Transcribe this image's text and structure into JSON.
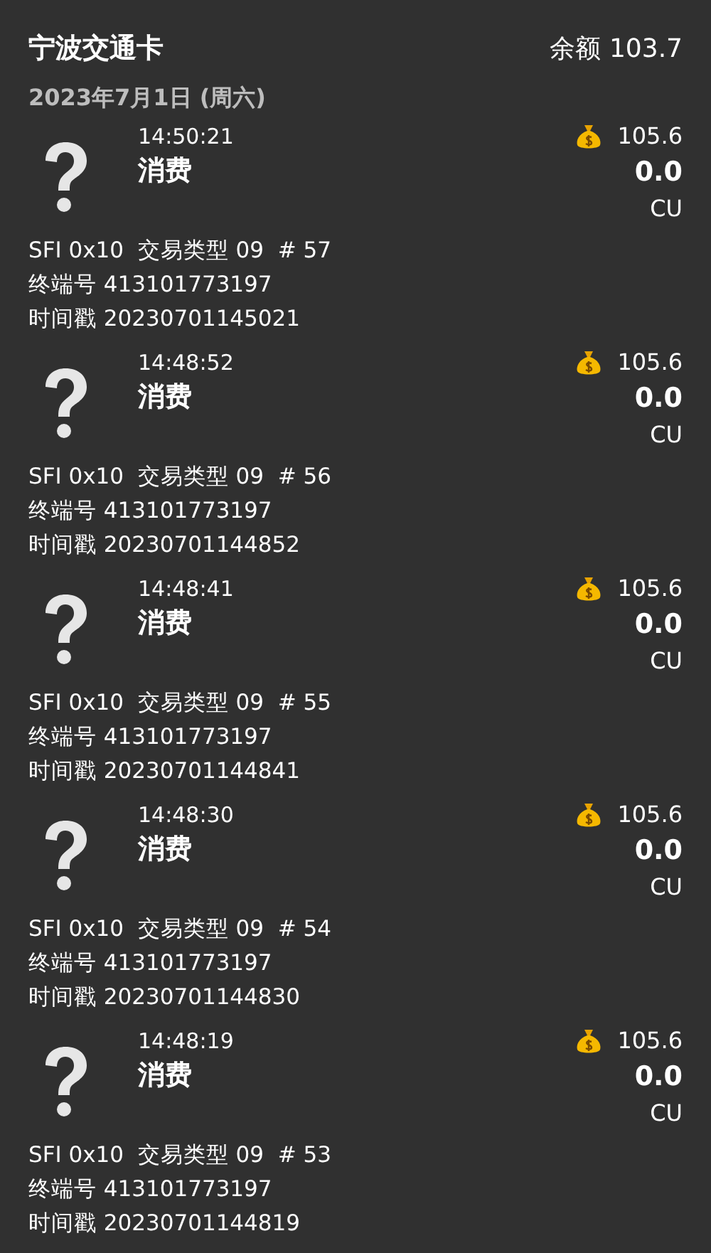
{
  "header": {
    "title": "宁波交通卡",
    "balance": "余额 103.7"
  },
  "date": "2023年7月1日 (周六)",
  "records": [
    {
      "time": "14:50:21",
      "type": "消费",
      "balance": "105.6",
      "amount": "0.0",
      "unit": "CU",
      "lines": [
        "SFI 0x10  交易类型 09  # 57",
        "终端号 413101773197",
        "时间戳 20230701145021"
      ]
    },
    {
      "time": "14:48:52",
      "type": "消费",
      "balance": "105.6",
      "amount": "0.0",
      "unit": "CU",
      "lines": [
        "SFI 0x10  交易类型 09  # 56",
        "终端号 413101773197",
        "时间戳 20230701144852"
      ]
    },
    {
      "time": "14:48:41",
      "type": "消费",
      "balance": "105.6",
      "amount": "0.0",
      "unit": "CU",
      "lines": [
        "SFI 0x10  交易类型 09  # 55",
        "终端号 413101773197",
        "时间戳 20230701144841"
      ]
    },
    {
      "time": "14:48:30",
      "type": "消费",
      "balance": "105.6",
      "amount": "0.0",
      "unit": "CU",
      "lines": [
        "SFI 0x10  交易类型 09  # 54",
        "终端号 413101773197",
        "时间戳 20230701144830"
      ]
    },
    {
      "time": "14:48:19",
      "type": "消费",
      "balance": "105.6",
      "amount": "0.0",
      "unit": "CU",
      "lines": [
        "SFI 0x10  交易类型 09  # 53",
        "终端号 413101773197",
        "时间戳 20230701144819"
      ]
    }
  ]
}
